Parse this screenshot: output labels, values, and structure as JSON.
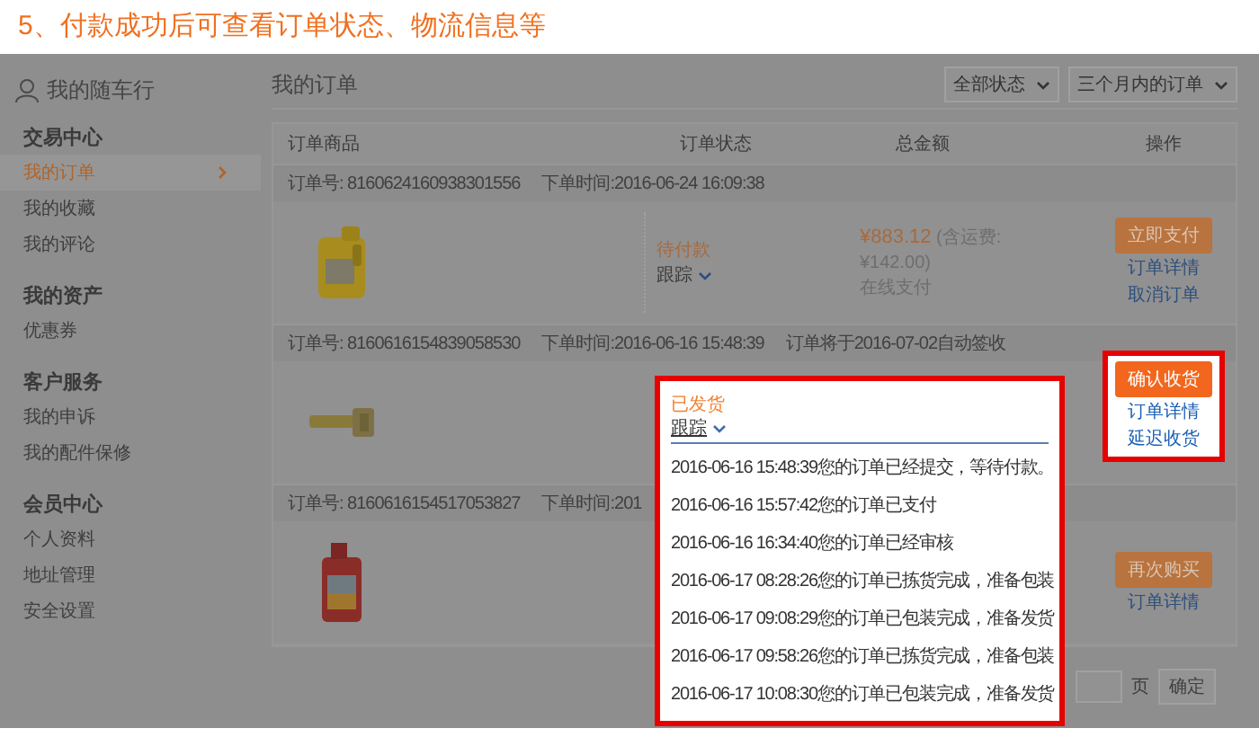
{
  "banner": {
    "title": "5、付款成功后可查看订单状态、物流信息等"
  },
  "sidebar": {
    "title": "我的随车行",
    "sections": [
      {
        "heading": "交易中心",
        "items": [
          {
            "label": "我的订单",
            "selected": true
          },
          {
            "label": "我的收藏",
            "selected": false
          },
          {
            "label": "我的评论",
            "selected": false
          }
        ]
      },
      {
        "heading": "我的资产",
        "items": [
          {
            "label": "优惠券",
            "selected": false
          }
        ]
      },
      {
        "heading": "客户服务",
        "items": [
          {
            "label": "我的申诉",
            "selected": false
          },
          {
            "label": "我的配件保修",
            "selected": false
          }
        ]
      },
      {
        "heading": "会员中心",
        "items": [
          {
            "label": "个人资料",
            "selected": false
          },
          {
            "label": "地址管理",
            "selected": false
          },
          {
            "label": "安全设置",
            "selected": false
          }
        ]
      }
    ]
  },
  "main": {
    "title": "我的订单",
    "filters": [
      "全部状态",
      "三个月内的订单"
    ]
  },
  "table": {
    "columns": [
      "订单商品",
      "订单状态",
      "总金额",
      "操作"
    ]
  },
  "orders": [
    {
      "number": "订单号: 8160624160938301556",
      "time": "下单时间:2016-06-24 16:09:38",
      "product": {
        "kind": "picture"
      },
      "status": "待付款",
      "track": "跟踪",
      "total": "¥883.12",
      "freight": "(含运费: ¥142.00)",
      "payment": "在线支付",
      "highlighted": false,
      "actions": [
        {
          "kind": "primary",
          "label": "立即支付"
        },
        {
          "kind": "link",
          "label": "订单详情"
        },
        {
          "kind": "link",
          "label": "取消订单"
        }
      ]
    },
    {
      "number": "订单号: 8160616154839058530",
      "time": "下单时间:2016-06-16 15:48:39",
      "note": "订单将于2016-07-02自动签收",
      "product": {
        "kind": "picture"
      },
      "highlighted": true,
      "tracking": {
        "status": "已发货",
        "track": "跟踪",
        "events": [
          "2016-06-16 15:48:39您的订单已经提交，等待付款。",
          "2016-06-16 15:57:42您的订单已支付",
          "2016-06-16 16:34:40您的订单已经审核",
          "2016-06-17 08:28:26您的订单已拣货完成，准备包装",
          "2016-06-17 09:08:29您的订单已包装完成，准备发货",
          "2016-06-17 09:58:26您的订单已拣货完成，准备包装",
          "2016-06-17 10:08:30您的订单已包装完成，准备发货"
        ]
      },
      "actions": [
        {
          "kind": "primary",
          "label": "确认收货"
        },
        {
          "kind": "link",
          "label": "订单详情"
        },
        {
          "kind": "link",
          "label": "延迟收货"
        }
      ]
    },
    {
      "number": "订单号: 8160616154517053827",
      "time": "下单时间:201",
      "product": {
        "kind": "picture"
      },
      "highlighted": false,
      "actions": [
        {
          "kind": "primary",
          "label": "再次购买"
        },
        {
          "kind": "link",
          "label": "订单详情"
        }
      ]
    }
  ],
  "pagination": {
    "page_label": "页",
    "confirm": "确定"
  }
}
